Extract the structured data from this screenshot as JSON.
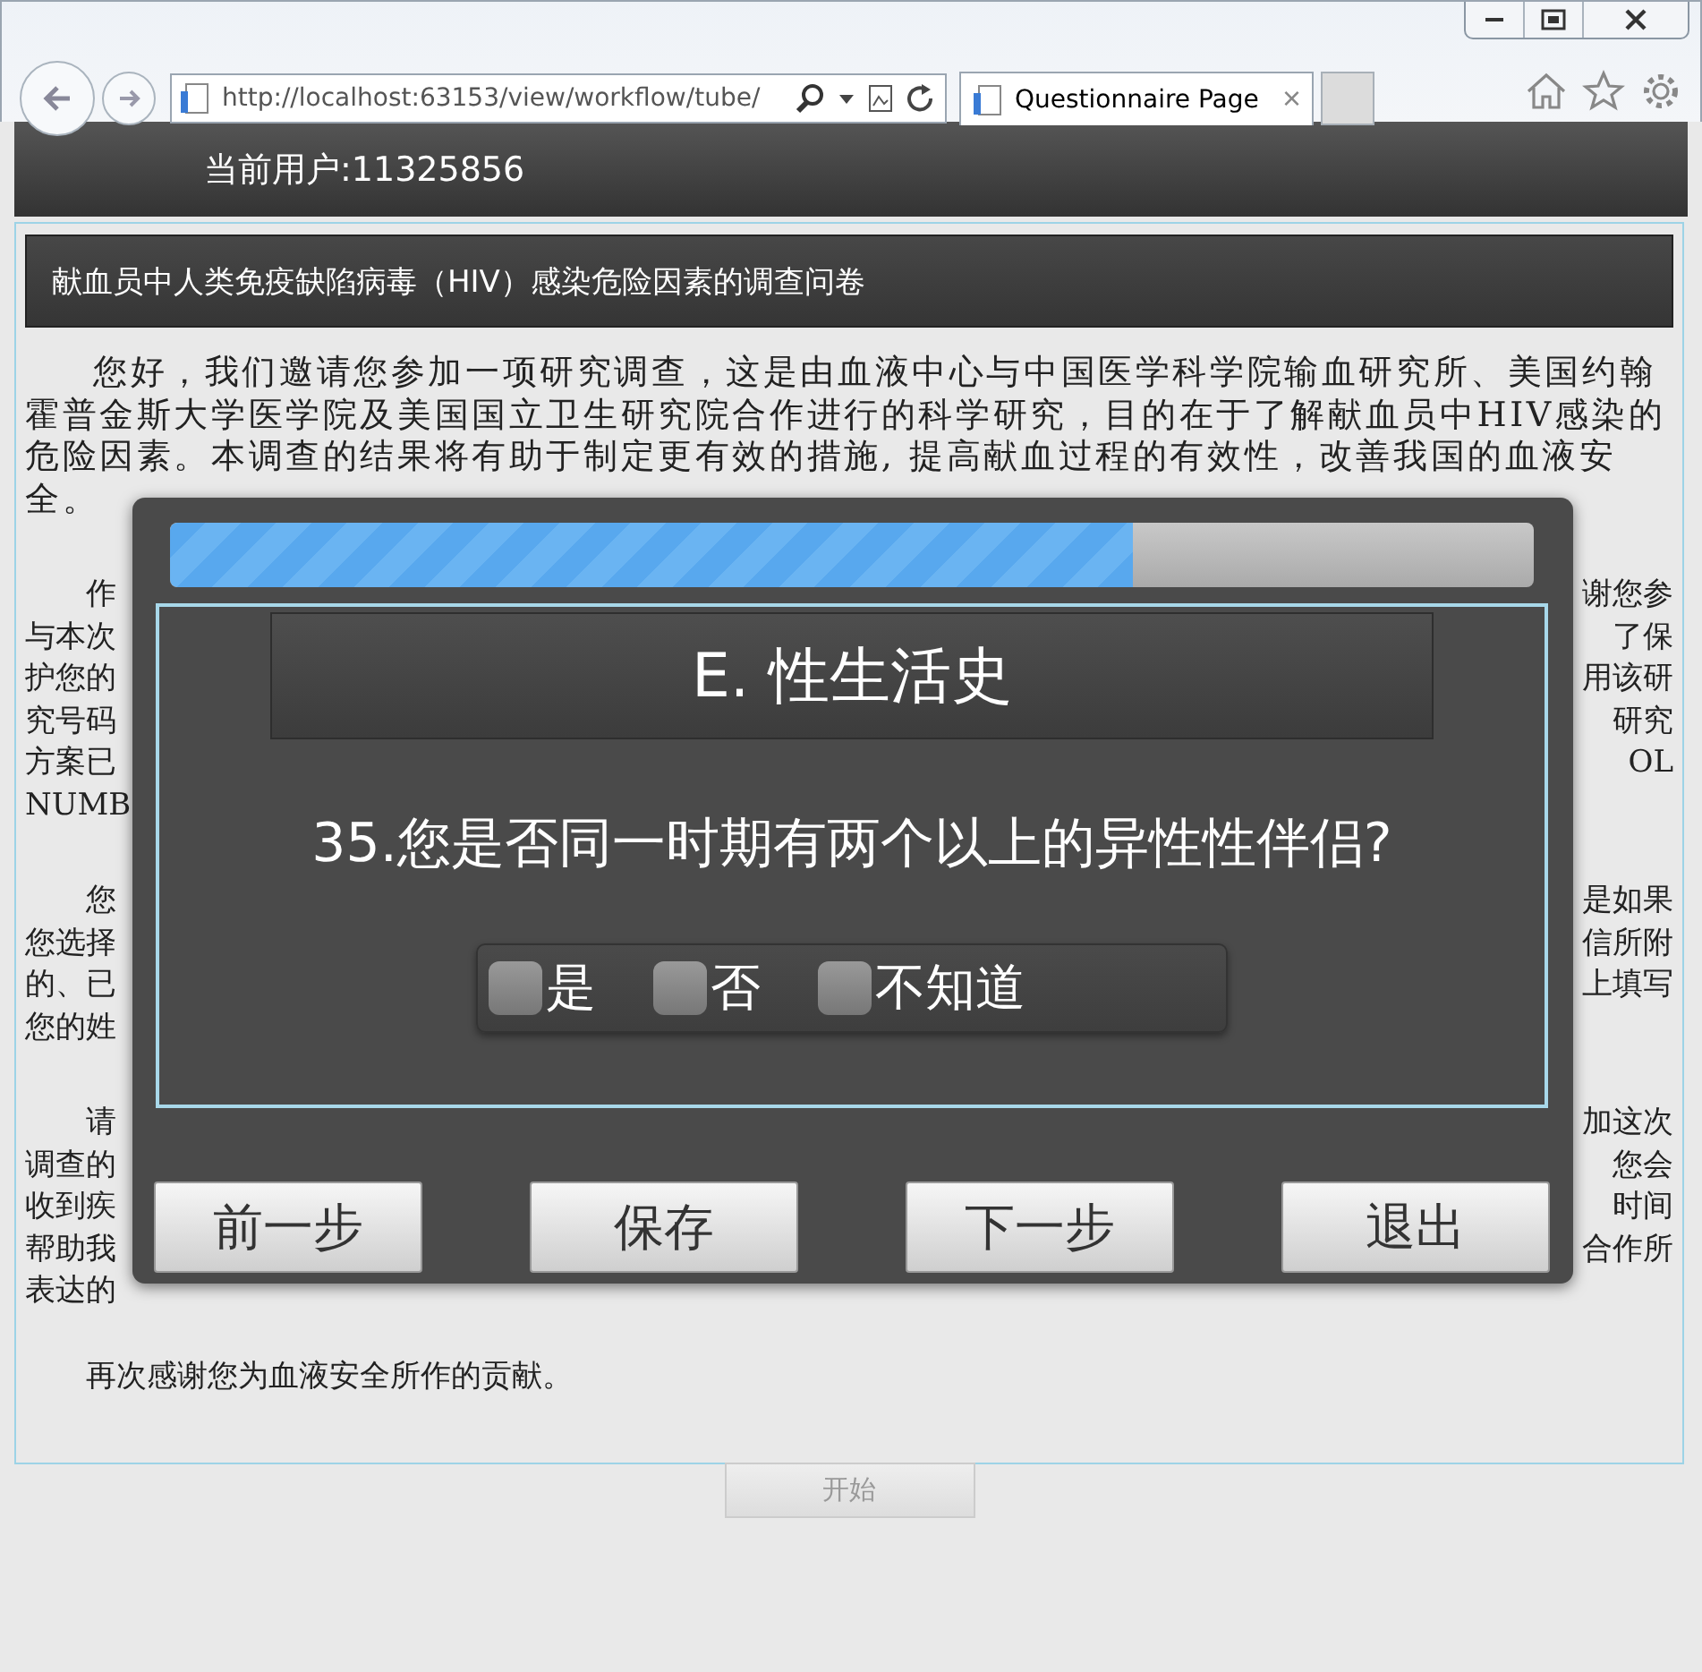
{
  "browser": {
    "url": "http://localhost:63153/view/workflow/tube/",
    "tab": {
      "title": "Questionnaire Page",
      "close": "×"
    }
  },
  "header": {
    "user": "当前用户:11325856"
  },
  "survey": {
    "title": "献血员中人类免疫缺陷病毒（HIV）感染危险因素的调查问卷",
    "intro": "您好，我们邀请您参加一项研究调查，这是由血液中心与中国医学科学院输血研究所、美国约翰霍普金斯大学医学院及美国国立卫生研究院合作进行的科学研究，目的在于了解献血员中HIV感染的危险因素。本调查的结果将有助于制定更有效的措施, 提高献血过程的有效性，改善我国的血液安全。",
    "partly_hidden": [
      [
        {
          "left": "作",
          "right": "谢您参"
        },
        {
          "left": "与本次",
          "right": "了保"
        },
        {
          "left": "护您的",
          "right": "用该研"
        },
        {
          "left": "究号码",
          "right": "研究"
        },
        {
          "left": "方案已",
          "right": "OL"
        },
        {
          "left": "NUMB"
        }
      ],
      [
        {
          "left": "您",
          "right": "是如果"
        },
        {
          "left": "您选择",
          "right": "信所附"
        },
        {
          "left": "的、已",
          "right": "上填写"
        },
        {
          "left": "您的姓"
        }
      ],
      [
        {
          "left": "请",
          "right": "加这次"
        },
        {
          "left": "调查的",
          "right": "您会"
        },
        {
          "left": "收到疾",
          "right": "时间"
        },
        {
          "left": "帮助我",
          "right": "合作所"
        },
        {
          "left": "表达的"
        }
      ]
    ],
    "closing": "再次感谢您为血液安全所作的贡献。",
    "start_button": {
      "label": "开始",
      "disabled": true
    }
  },
  "dialog": {
    "progress": {
      "level": 0.706
    },
    "section": "E. 性生活史",
    "question": "35.您是否同一时期有两个以上的异性性伴侣?",
    "options": [
      {
        "label": "是",
        "checked": false
      },
      {
        "label": "否",
        "checked": false
      },
      {
        "label": "不知道",
        "checked": false
      }
    ],
    "buttons": [
      "前一步",
      "保存",
      "下一步",
      "退出"
    ]
  }
}
